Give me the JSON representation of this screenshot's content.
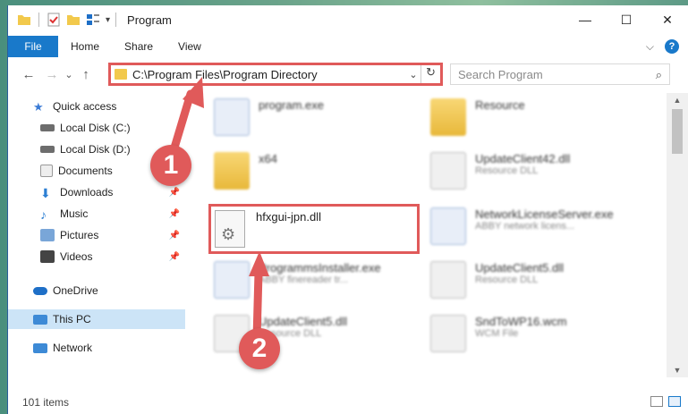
{
  "window": {
    "title": "Program",
    "controls": {
      "minimize": "—",
      "maximize": "☐",
      "close": "✕"
    }
  },
  "ribbon": {
    "file": "File",
    "tabs": [
      "Home",
      "Share",
      "View"
    ],
    "collapse": "⌵",
    "help": "?"
  },
  "nav": {
    "back": "←",
    "forward": "→",
    "recent": "⌄",
    "up": "↑"
  },
  "address": {
    "path": "C:\\Program Files\\Program Directory",
    "dropdown": "⌄",
    "refresh": "↻"
  },
  "search": {
    "placeholder": "Search Program",
    "icon": "⌕"
  },
  "sidebar": {
    "items": [
      {
        "label": "Quick access",
        "icon": "star-icon",
        "color": "#3a7bd5"
      },
      {
        "label": "Local Disk (C:)",
        "icon": "drive-icon",
        "color": "#6d6d6d"
      },
      {
        "label": "Local Disk (D:)",
        "icon": "drive-icon",
        "color": "#6d6d6d"
      },
      {
        "label": "Documents",
        "icon": "documents-icon",
        "color": "#e7e7e7"
      },
      {
        "label": "Downloads",
        "icon": "download-icon",
        "color": "#2d7fd3"
      },
      {
        "label": "Music",
        "icon": "music-icon",
        "color": "#2d7fd3"
      },
      {
        "label": "Pictures",
        "icon": "pictures-icon",
        "color": "#79a6d8"
      },
      {
        "label": "Videos",
        "icon": "videos-icon",
        "color": "#444"
      },
      {
        "label": "OneDrive",
        "icon": "cloud-icon",
        "color": "#1e6fc7"
      },
      {
        "label": "This PC",
        "icon": "computer-icon",
        "color": "#3d8ad6"
      },
      {
        "label": "Network",
        "icon": "network-icon",
        "color": "#3d8ad6"
      }
    ],
    "pin": "📌"
  },
  "files": [
    {
      "name": "program.exe",
      "sub": "",
      "kind": "exe"
    },
    {
      "name": "Resource",
      "sub": "",
      "kind": "folder"
    },
    {
      "name": "x64",
      "sub": "",
      "kind": "folder"
    },
    {
      "name": "UpdateClient42.dll",
      "sub": "Resource DLL",
      "kind": "dll"
    },
    {
      "name": "hfxgui-jpn.dll",
      "sub": "",
      "kind": "dll"
    },
    {
      "name": "NetworkLicenseServer.exe",
      "sub": "ABBY network licens...",
      "kind": "exe"
    },
    {
      "name": "ProgrammsInstaller.exe",
      "sub": "ABBY finereader tr...",
      "kind": "exe"
    },
    {
      "name": "UpdateClient5.dll",
      "sub": "Resource DLL",
      "kind": "dll"
    },
    {
      "name": "UpdateClient5.dll",
      "sub": "Resource DLL",
      "kind": "dll"
    },
    {
      "name": "SndToWP16.wcm",
      "sub": "WCM File",
      "kind": "dll"
    }
  ],
  "annotations": {
    "step1": "1",
    "step2": "2",
    "color": "#e05a5a"
  },
  "status": {
    "count": "101 items"
  }
}
